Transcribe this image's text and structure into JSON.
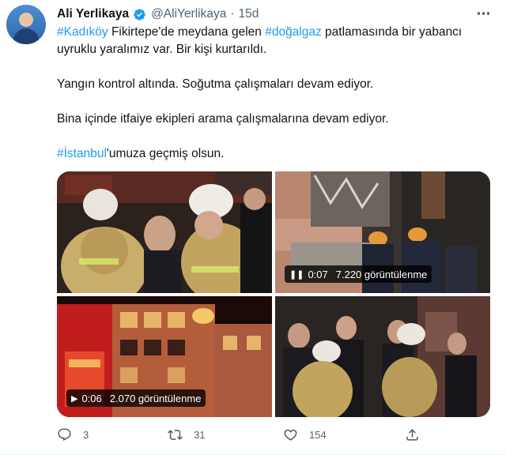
{
  "author": {
    "name": "Ali Yerlikaya",
    "handle": "@AliYerlikaya",
    "separator": "·",
    "time": "15d"
  },
  "tweet": {
    "line1": {
      "tag1": "#Kadıköy",
      "text1": " Fikirtepe'de meydana gelen ",
      "tag2": "#doğalgaz",
      "text2": " patlamasında bir yabancı"
    },
    "line2": "uyruklu yaralımız var. Bir kişi kurtarıldı.",
    "line3": "Yangın kontrol altında. Soğutma çalışmaları devam ediyor.",
    "line4": "Bina içinde itfaiye ekipleri arama çalışmalarına devam ediyor.",
    "line5": {
      "tag": "#İstanbul",
      "text": "'umuza geçmiş olsun."
    }
  },
  "media": {
    "video1": {
      "icon": "pause-icon",
      "duration": "0:07",
      "views": "7.220 görüntülenme"
    },
    "video2": {
      "icon": "play-icon",
      "duration": "0:06",
      "views": "2.070 görüntülenme"
    }
  },
  "actions": {
    "replies": "3",
    "retweets": "31",
    "likes": "154"
  },
  "colors": {
    "link": "#1d9bf0",
    "muted": "#536471",
    "text": "#0f1419"
  }
}
